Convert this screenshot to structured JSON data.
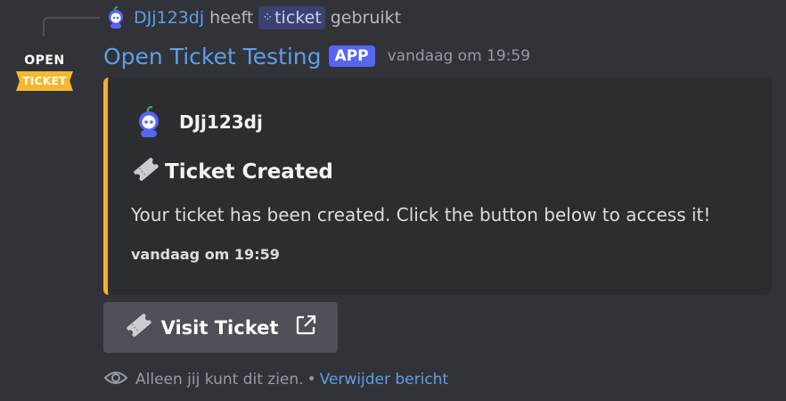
{
  "reply": {
    "username": "DJj123dj",
    "verb": "heeft",
    "command": "ticket",
    "suffix": "gebruikt"
  },
  "bot": {
    "logo_line1": "OPEN",
    "logo_line2": "TICKET",
    "name": "Open Ticket Testing",
    "badge": "APP",
    "timestamp": "vandaag om 19:59"
  },
  "embed": {
    "accent_color": "#f0b232",
    "author": "DJj123dj",
    "title_icon": "ticket-icon",
    "title": "Ticket Created",
    "description": "Your ticket has been created. Click the button below to access it!",
    "footer": "vandaag om 19:59"
  },
  "button": {
    "label": "Visit Ticket",
    "icon": "ticket-icon",
    "trailing_icon": "external-link-icon"
  },
  "ephemeral": {
    "icon": "eye-icon",
    "text": "Alleen jij kunt dit zien.",
    "separator": "•",
    "dismiss_label": "Verwijder bericht"
  },
  "colors": {
    "background": "#313338",
    "embed_bg": "#2b2d31",
    "link": "#5e9ee8",
    "brand": "#5865f2"
  }
}
